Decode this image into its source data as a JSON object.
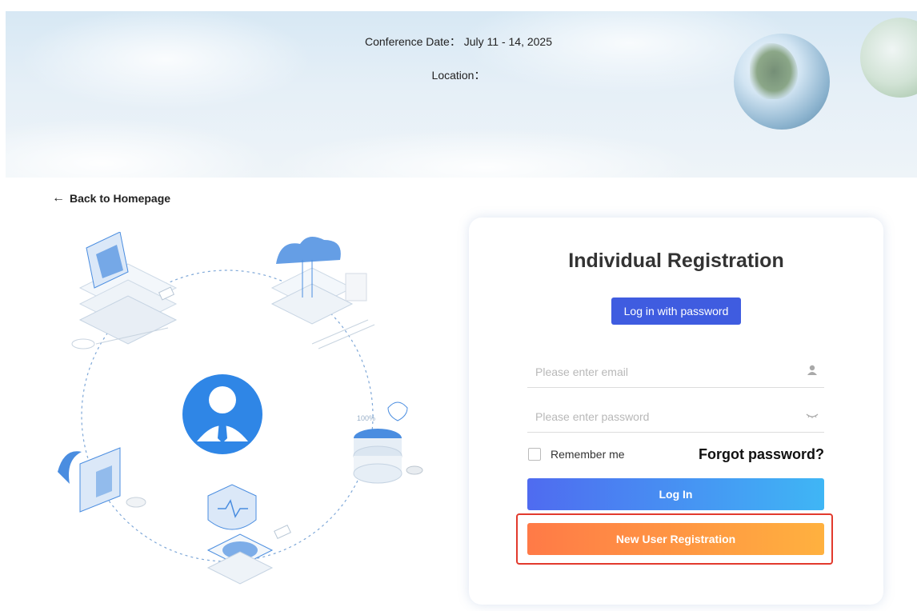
{
  "banner": {
    "date_text": "Conference Date： July 11 - 14, 2025",
    "location_text": "Location："
  },
  "nav": {
    "back_label": "Back to Homepage",
    "back_icon": "arrow-left-icon"
  },
  "illustration": {
    "center_icon": "user-avatar-icon",
    "percent_label": "100%"
  },
  "card": {
    "title": "Individual Registration",
    "password_mode_label": "Log in with password",
    "email_placeholder": "Please enter email",
    "email_icon": "user-icon",
    "password_placeholder": "Please enter password",
    "password_icon": "eye-closed-icon",
    "remember_label": "Remember me",
    "remember_checked": false,
    "forgot_label": "Forgot password?",
    "login_label": "Log In",
    "register_label": "New User Registration"
  },
  "colors": {
    "primary": "#3f5ce0",
    "login_gradient": [
      "#4f6bf0",
      "#3fb6f5"
    ],
    "register_gradient": [
      "#ff7a47",
      "#ffb13f"
    ],
    "highlight": "#e23a2d"
  }
}
